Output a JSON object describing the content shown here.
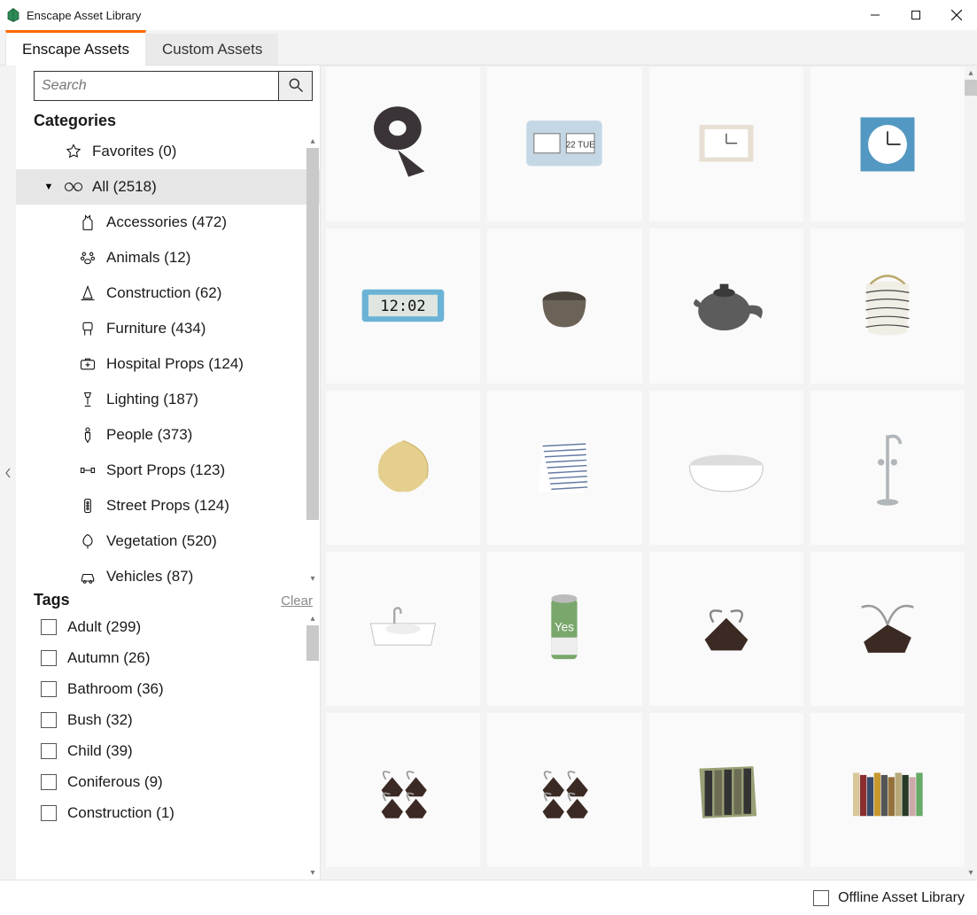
{
  "window": {
    "title": "Enscape Asset Library"
  },
  "tabs": [
    {
      "label": "Enscape Assets",
      "active": true
    },
    {
      "label": "Custom Assets",
      "active": false
    }
  ],
  "search": {
    "placeholder": "Search",
    "value": ""
  },
  "sidebar": {
    "categories_label": "Categories",
    "favorites": {
      "label": "Favorites",
      "count": "(0)"
    },
    "all": {
      "label": "All",
      "count": "(2518)"
    },
    "children": [
      {
        "icon": "accessories",
        "label": "Accessories",
        "count": "(472)"
      },
      {
        "icon": "animals",
        "label": "Animals",
        "count": "(12)"
      },
      {
        "icon": "construction",
        "label": "Construction",
        "count": "(62)"
      },
      {
        "icon": "furniture",
        "label": "Furniture",
        "count": "(434)"
      },
      {
        "icon": "hospital",
        "label": "Hospital Props",
        "count": "(124)"
      },
      {
        "icon": "lighting",
        "label": "Lighting",
        "count": "(187)"
      },
      {
        "icon": "people",
        "label": "People",
        "count": "(373)"
      },
      {
        "icon": "sport",
        "label": "Sport Props",
        "count": "(123)"
      },
      {
        "icon": "street",
        "label": "Street Props",
        "count": "(124)"
      },
      {
        "icon": "vegetation",
        "label": "Vegetation",
        "count": "(520)"
      },
      {
        "icon": "vehicles",
        "label": "Vehicles",
        "count": "(87)"
      }
    ],
    "tags_label": "Tags",
    "clear_label": "Clear",
    "tags": [
      {
        "label": "Adult",
        "count": "(299)"
      },
      {
        "label": "Autumn",
        "count": "(26)"
      },
      {
        "label": "Bathroom",
        "count": "(36)"
      },
      {
        "label": "Bush",
        "count": "(32)"
      },
      {
        "label": "Child",
        "count": "(39)"
      },
      {
        "label": "Coniferous",
        "count": "(9)"
      },
      {
        "label": "Construction",
        "count": "(1)"
      }
    ]
  },
  "assets": [
    {
      "name": "Tape Dispenser",
      "shape": "tape",
      "color1": "#3a3338",
      "color2": "#777"
    },
    {
      "name": "Flip Clock",
      "shape": "flipclock",
      "color1": "#c4d7e5",
      "color2": "#fff",
      "text": "22 TUE"
    },
    {
      "name": "Analog Clock Beige",
      "shape": "analog",
      "color1": "#e7e0d2",
      "color2": "#fff"
    },
    {
      "name": "Alarm Clock Blue",
      "shape": "alarm",
      "color1": "#5398c2",
      "color2": "#fff"
    },
    {
      "name": "Digital Clock",
      "shape": "digital",
      "color1": "#6bb3d6",
      "color2": "#111",
      "text": "12:02"
    },
    {
      "name": "Mortar Bowl",
      "shape": "bowl",
      "color1": "#6b6258",
      "color2": "#4a433b"
    },
    {
      "name": "Teapot",
      "shape": "teapot",
      "color1": "#5c5c5c",
      "color2": "#3a3a3a"
    },
    {
      "name": "Laundry Basket",
      "shape": "basket",
      "color1": "#f1eee6",
      "color2": "#444"
    },
    {
      "name": "Woven Basket",
      "shape": "woven",
      "color1": "#e4cf8f",
      "color2": "#c9ae5c"
    },
    {
      "name": "Towel Striped",
      "shape": "towel",
      "color1": "#ffffff",
      "color2": "#6379a1"
    },
    {
      "name": "Bathtub",
      "shape": "tub",
      "color1": "#ffffff",
      "color2": "#ddd"
    },
    {
      "name": "Floor Faucet",
      "shape": "faucet",
      "color1": "#b0b6ba",
      "color2": "#888"
    },
    {
      "name": "Sink",
      "shape": "sink",
      "color1": "#ffffff",
      "color2": "#ccc"
    },
    {
      "name": "Beverage Can",
      "shape": "can",
      "color1": "#7aa76b",
      "color2": "#eee",
      "text": "Yes"
    },
    {
      "name": "Binder Clip Large",
      "shape": "clip",
      "color1": "#3b2a24",
      "color2": "#888"
    },
    {
      "name": "Binder Clip Open",
      "shape": "clip2",
      "color1": "#3b2a24",
      "color2": "#999"
    },
    {
      "name": "Binder Clips Pile A",
      "shape": "clips",
      "color1": "#3b2a24",
      "color2": "#999"
    },
    {
      "name": "Binder Clips Pile B",
      "shape": "clips",
      "color1": "#3b2a24",
      "color2": "#999"
    },
    {
      "name": "Folder Binders",
      "shape": "folders",
      "color1": "#9aa076",
      "color2": "#333"
    },
    {
      "name": "Book Row",
      "shape": "books",
      "color1": "#ded0b0",
      "color2": "#8a2e2e"
    }
  ],
  "statusbar": {
    "offline_label": "Offline Asset Library"
  }
}
